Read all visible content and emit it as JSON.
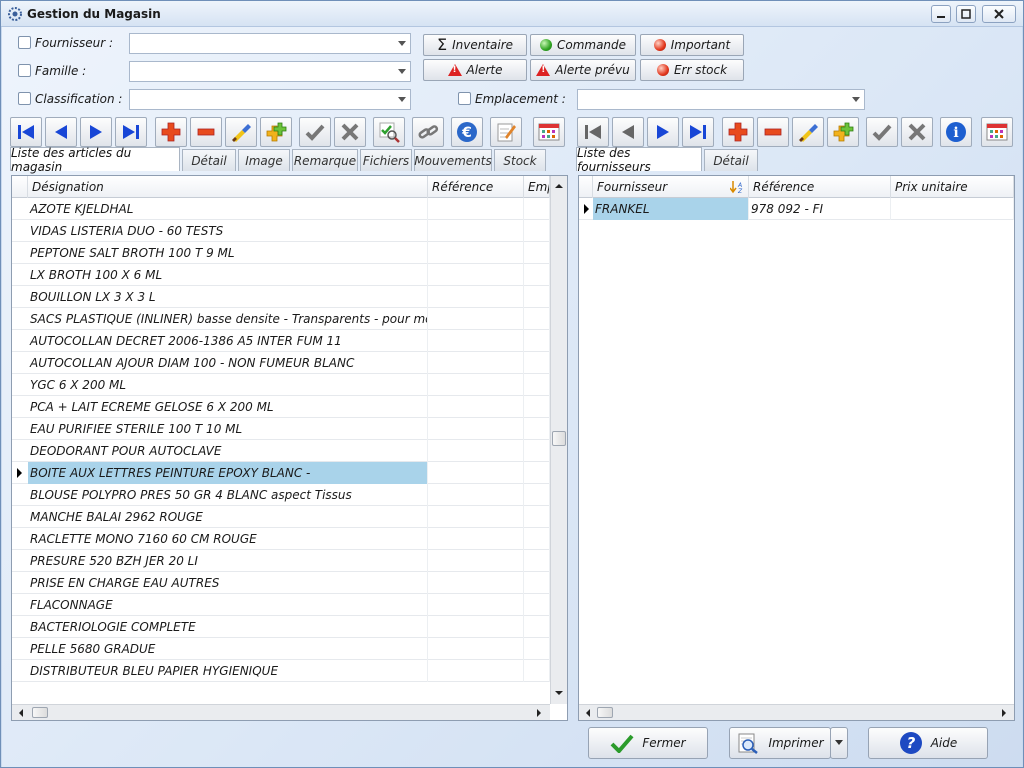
{
  "window": {
    "title": "Gestion du Magasin"
  },
  "filters": {
    "fournisseur_label": "Fournisseur :",
    "famille_label": "Famille :",
    "classification_label": "Classification :",
    "emplacement_label": "Emplacement :"
  },
  "filter_buttons": {
    "inventaire": "Inventaire",
    "commande": "Commande",
    "important": "Important",
    "alerte": "Alerte",
    "alerte_prevu": "Alerte prévu",
    "err_stock": "Err stock"
  },
  "left_tabs": [
    "Liste des articles du magasin",
    "Détail",
    "Image",
    "Remarque",
    "Fichiers",
    "Mouvements",
    "Stock"
  ],
  "right_tabs": [
    "Liste des fournisseurs",
    "Détail"
  ],
  "articles": {
    "columns": [
      "Désignation",
      "Référence",
      "Emp"
    ],
    "rows": [
      "AZOTE KJELDHAL",
      "VIDAS LISTERIA DUO - 60 TESTS",
      "PEPTONE SALT BROTH 100 T 9 ML",
      "LX BROTH 100 X 6 ML",
      "BOUILLON LX 3 X 3 L",
      "SACS PLASTIQUE (INLINER) basse densite - Transparents - pour modele",
      "AUTOCOLLAN DECRET 2006-1386 A5 INTER FUM 11",
      "AUTOCOLLAN AJOUR DIAM 100 - NON FUMEUR BLANC",
      "YGC 6 X 200 ML",
      "PCA + LAIT ECREME GELOSE 6 X 200 ML",
      "EAU PURIFIEE STERILE 100 T 10 ML",
      "DEODORANT POUR AUTOCLAVE",
      "BOITE AUX LETTRES PEINTURE EPOXY BLANC -",
      "BLOUSE POLYPRO PRES 50 GR 4 BLANC aspect Tissus",
      "MANCHE BALAI  2962 ROUGE",
      "RACLETTE MONO 7160 60 CM ROUGE",
      "PRESURE 520 BZH JER 20 LI",
      "PRISE EN CHARGE EAU AUTRES",
      "FLACONNAGE",
      "BACTERIOLOGIE COMPLETE",
      "PELLE 5680 GRADUE",
      "DISTRIBUTEUR BLEU PAPIER HYGIENIQUE"
    ],
    "selected_index": 12
  },
  "suppliers": {
    "columns": [
      "Fournisseur",
      "Référence",
      "Prix unitaire"
    ],
    "rows": [
      {
        "fournisseur": "FRANKEL",
        "reference": "978 092 - FI",
        "prix": ""
      }
    ]
  },
  "bottom_buttons": {
    "fermer": "Fermer",
    "imprimer": "Imprimer",
    "aide": "Aide"
  }
}
